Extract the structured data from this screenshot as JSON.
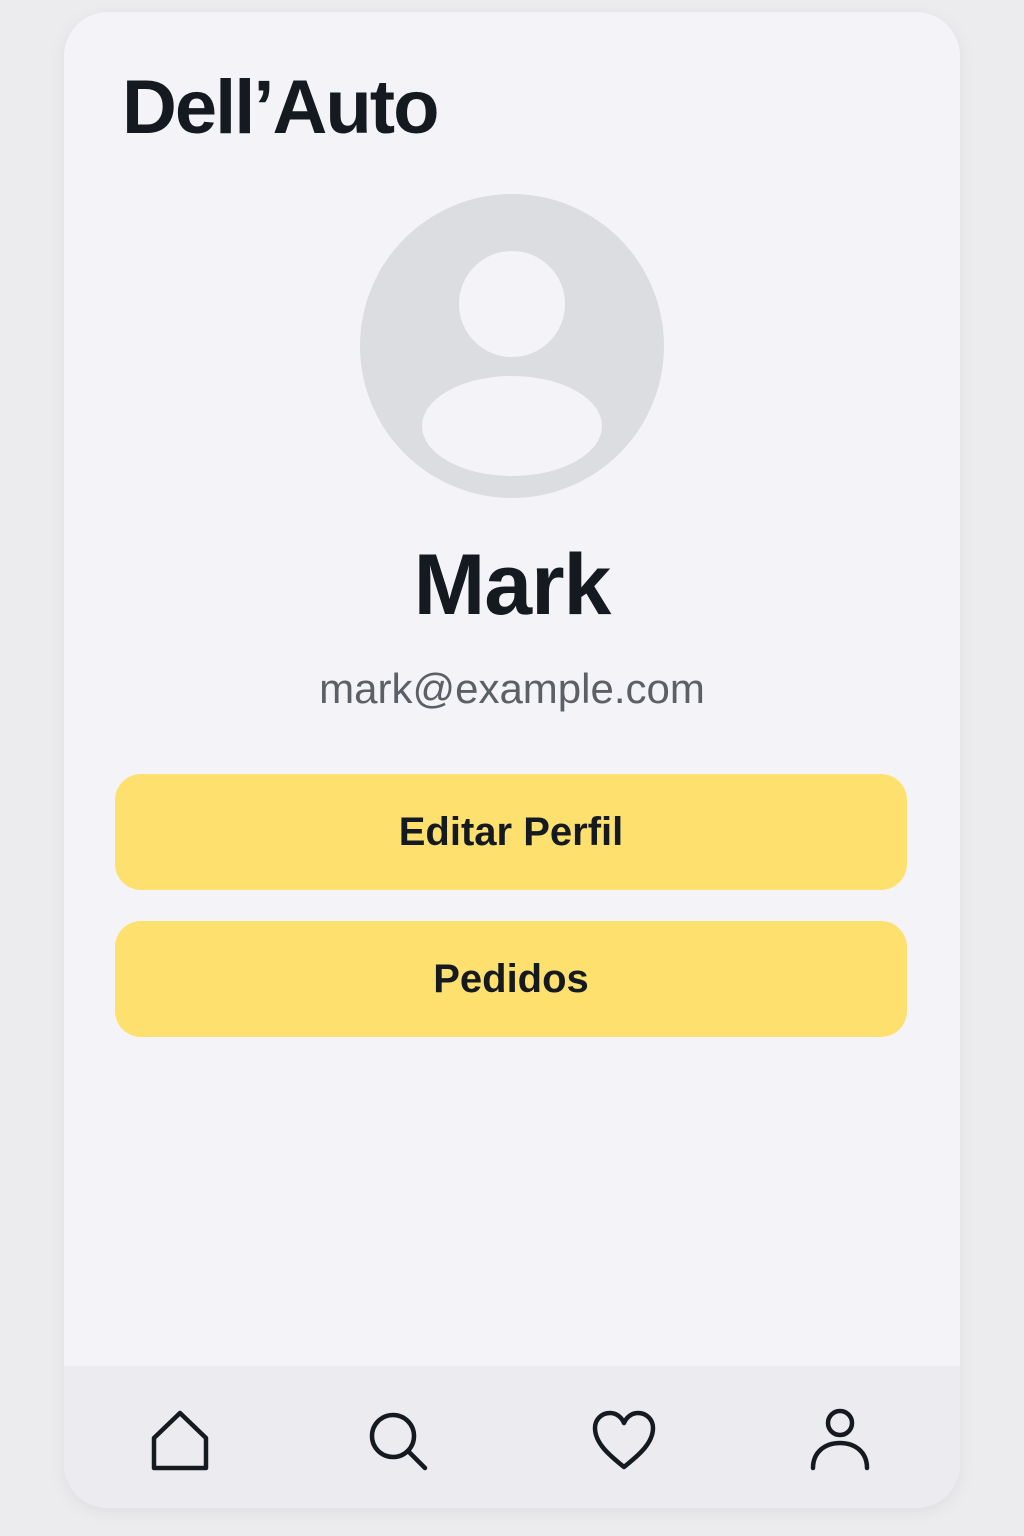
{
  "app": {
    "brand": "Dell’Auto"
  },
  "profile": {
    "name": "Mark",
    "email": "mark@example.com",
    "avatar_icon": "user-placeholder-icon"
  },
  "actions": {
    "edit_label": "Editar Perfil",
    "orders_label": "Pedidos"
  },
  "tabbar": {
    "items": [
      {
        "icon": "home-icon"
      },
      {
        "icon": "search-icon"
      },
      {
        "icon": "heart-icon"
      },
      {
        "icon": "user-icon"
      }
    ]
  },
  "colors": {
    "background": "#f4f4f8",
    "accent": "#fee06f",
    "text": "#151a20",
    "muted_text": "#5c6066",
    "avatar_bg": "#dcdde1",
    "tabbar_bg": "#ececf0"
  }
}
